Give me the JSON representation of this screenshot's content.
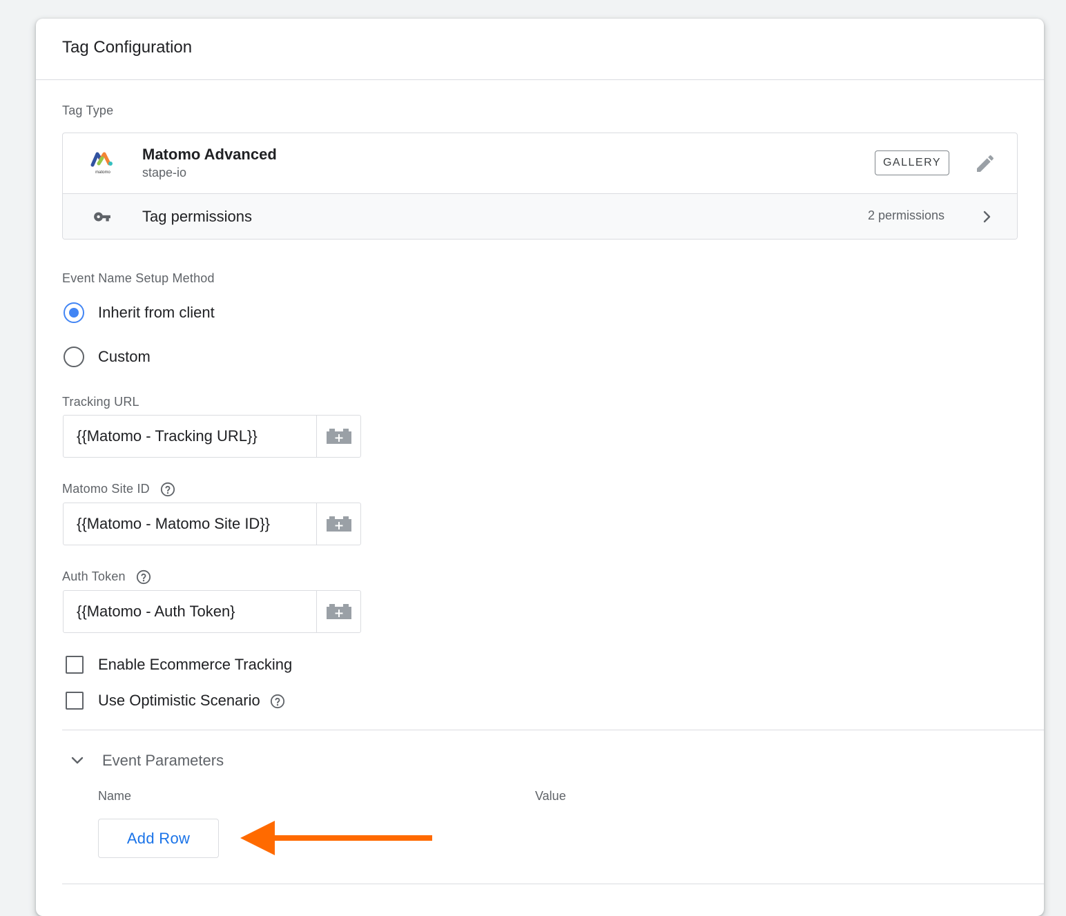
{
  "card": {
    "title": "Tag Configuration"
  },
  "tag_type": {
    "section_label": "Tag Type",
    "name": "Matomo Advanced",
    "vendor": "stape-io",
    "logo_text": "matomo",
    "gallery_label": "GALLERY",
    "permissions_label": "Tag permissions",
    "permissions_count": "2 permissions"
  },
  "event_name_setup": {
    "label": "Event Name Setup Method",
    "options": [
      {
        "label": "Inherit from client",
        "selected": true
      },
      {
        "label": "Custom",
        "selected": false
      }
    ]
  },
  "fields": {
    "tracking_url": {
      "label": "Tracking URL",
      "value": "{{Matomo - Tracking URL}}"
    },
    "site_id": {
      "label": "Matomo Site ID",
      "value": "{{Matomo - Matomo Site ID}}"
    },
    "auth_token": {
      "label": "Auth Token",
      "value": "{{Matomo - Auth Token}"
    }
  },
  "checkboxes": [
    {
      "label": "Enable Ecommerce Tracking",
      "checked": false
    },
    {
      "label": "Use Optimistic Scenario",
      "checked": false
    }
  ],
  "event_parameters": {
    "title": "Event Parameters",
    "expanded": true,
    "columns": [
      "Name",
      "Value"
    ],
    "add_row_label": "Add Row"
  },
  "colors": {
    "accent_blue": "#1a73e8",
    "radio_blue": "#4285f4",
    "annotation_arrow": "#ff6a00"
  },
  "icons": {
    "edit": "pencil-icon",
    "permissions": "key-icon",
    "chevron": "chevron-right-icon",
    "variable": "variable-picker-icon",
    "help": "help-icon",
    "collapse": "chevron-down-icon"
  }
}
